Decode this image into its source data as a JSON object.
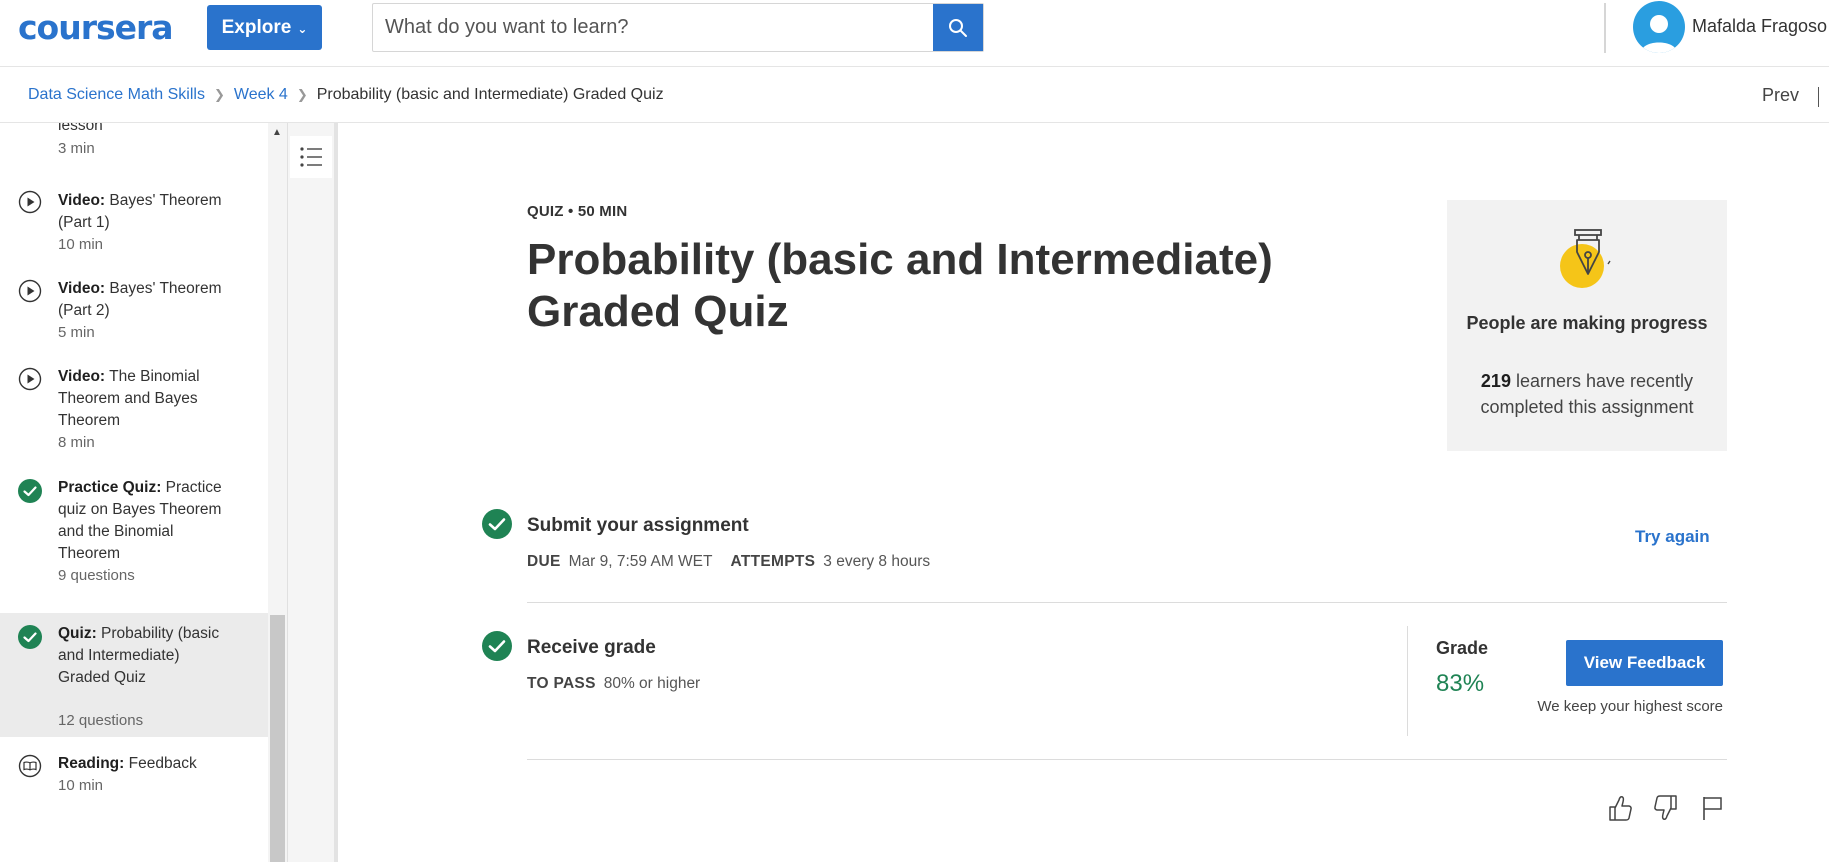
{
  "header": {
    "logo": "coursera",
    "explore_label": "Explore",
    "search_placeholder": "What do you want to learn?",
    "user_name": "Mafalda Fragoso"
  },
  "breadcrumb": {
    "items": [
      "Data Science Math Skills",
      "Week 4"
    ],
    "current": "Probability (basic and Intermediate) Graded Quiz",
    "prev_label": "Prev"
  },
  "sidebar": {
    "items": [
      {
        "icon": "play-circle-icon",
        "type": "",
        "title": "lesson",
        "meta": "3 min",
        "done": false,
        "active": false
      },
      {
        "icon": "play-circle-icon",
        "type": "Video:",
        "title": " Bayes' Theorem (Part 1)",
        "meta": "10 min",
        "done": false,
        "active": false
      },
      {
        "icon": "play-circle-icon",
        "type": "Video:",
        "title": " Bayes' Theorem (Part 2)",
        "meta": "5 min",
        "done": false,
        "active": false
      },
      {
        "icon": "play-circle-icon",
        "type": "Video:",
        "title": " The Binomial Theorem and Bayes Theorem",
        "meta": "8 min",
        "done": false,
        "active": false
      },
      {
        "icon": "check-circle-icon",
        "type": "Practice Quiz:",
        "title": " Practice quiz on Bayes Theorem and the Binomial Theorem",
        "meta": "9 questions",
        "done": true,
        "active": false
      },
      {
        "icon": "check-circle-icon",
        "type": "Quiz:",
        "title": " Probability (basic and Intermediate) Graded Quiz",
        "meta": "12 questions",
        "done": true,
        "active": true
      },
      {
        "icon": "book-icon",
        "type": "Reading:",
        "title": " Feedback",
        "meta": "10 min",
        "done": false,
        "active": false
      }
    ]
  },
  "main": {
    "quiz_meta": "QUIZ • 50 MIN",
    "title": "Probability (basic and Intermediate) Graded Quiz",
    "progress_card": {
      "title": "People are making progress",
      "count": "219",
      "text": " learners have recently completed this assignment"
    },
    "submit": {
      "title": "Submit your assignment",
      "due_label": "DUE",
      "due_value": "Mar 9, 7:59 AM WET",
      "attempts_label": "ATTEMPTS",
      "attempts_value": "3 every 8 hours",
      "action": "Try again"
    },
    "receive": {
      "title": "Receive grade",
      "pass_label": "TO PASS",
      "pass_value": "80% or higher",
      "grade_label": "Grade",
      "grade_value": "83%",
      "button": "View Feedback",
      "note": "We keep your highest score"
    }
  },
  "colors": {
    "accent": "#2a73cc",
    "success": "#1f8354",
    "pen_yellow": "#f5c518"
  }
}
